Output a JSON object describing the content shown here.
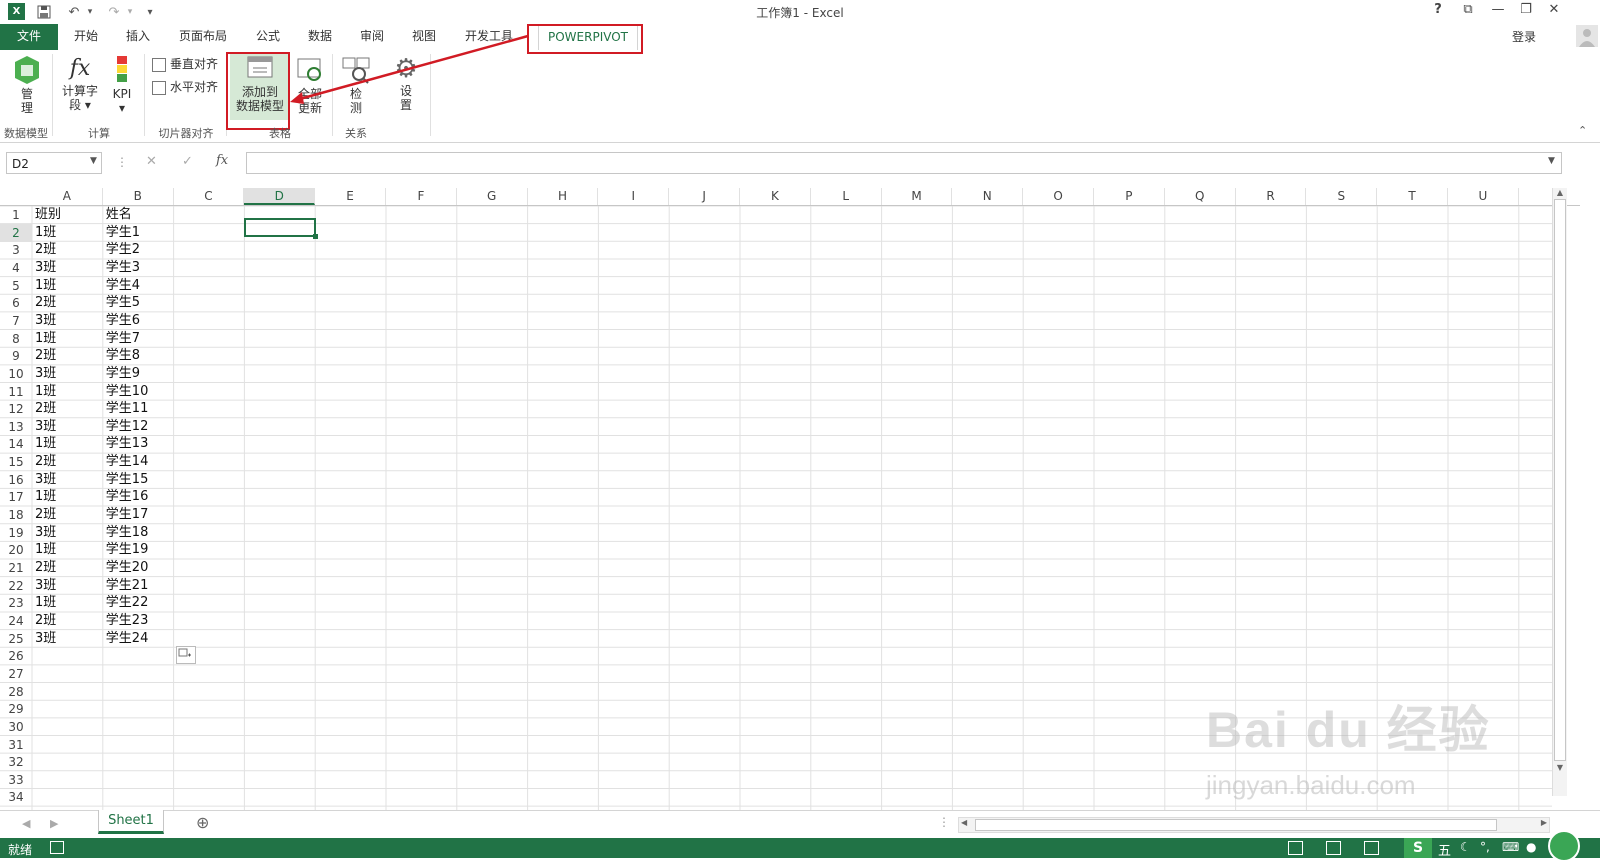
{
  "window": {
    "title": "工作簿1 - Excel",
    "help": "?",
    "ribbon_display": "⧉",
    "minimize": "—",
    "restore": "❐",
    "close": "✕"
  },
  "qat": {
    "undo": "↶",
    "redo": "↷",
    "customize": "▾"
  },
  "tabs": [
    "文件",
    "开始",
    "插入",
    "页面布局",
    "公式",
    "数据",
    "审阅",
    "视图",
    "开发工具",
    "POWERPIVOT"
  ],
  "signin": "登录",
  "ribbon": {
    "manage": "管\n理",
    "calc_field": "计算字\n段 ▾",
    "kpi": "KPI\n▾",
    "vert_align": "垂直对齐",
    "horz_align": "水平对齐",
    "add_to_model": "添加到\n数据模型",
    "refresh_all": "全部\n更新",
    "detect": "检\n测",
    "settings": "设\n置",
    "groups": [
      "数据模型",
      "计算",
      "切片器对齐",
      "表格",
      "关系"
    ]
  },
  "formula_bar": {
    "name_box": "D2",
    "cancel": "✕",
    "enter": "✓",
    "fx": "fx",
    "value": ""
  },
  "columns": [
    "A",
    "B",
    "C",
    "D",
    "E",
    "F",
    "G",
    "H",
    "I",
    "J",
    "K",
    "L",
    "M",
    "N",
    "O",
    "P",
    "Q",
    "R",
    "S",
    "T",
    "U"
  ],
  "rows": [
    "1",
    "2",
    "3",
    "4",
    "5",
    "6",
    "7",
    "8",
    "9",
    "10",
    "11",
    "12",
    "13",
    "14",
    "15",
    "16",
    "17",
    "18",
    "19",
    "20",
    "21",
    "22",
    "23",
    "24",
    "25",
    "26",
    "27",
    "28",
    "29",
    "30",
    "31",
    "32",
    "33",
    "34"
  ],
  "table": {
    "col_a": [
      "班别",
      "1班",
      "2班",
      "3班",
      "1班",
      "2班",
      "3班",
      "1班",
      "2班",
      "3班",
      "1班",
      "2班",
      "3班",
      "1班",
      "2班",
      "3班",
      "1班",
      "2班",
      "3班",
      "1班",
      "2班",
      "3班",
      "1班",
      "2班",
      "3班"
    ],
    "col_b": [
      "姓名",
      "学生1",
      "学生2",
      "学生3",
      "学生4",
      "学生5",
      "学生6",
      "学生7",
      "学生8",
      "学生9",
      "学生10",
      "学生11",
      "学生12",
      "学生13",
      "学生14",
      "学生15",
      "学生16",
      "学生17",
      "学生18",
      "学生19",
      "学生20",
      "学生21",
      "学生22",
      "学生23",
      "学生24"
    ]
  },
  "selected_cell": "D2",
  "sheets": [
    "Sheet1"
  ],
  "add_sheet": "⊕",
  "status": {
    "ready": "就绪",
    "ime": "五"
  },
  "watermark": {
    "logo": "Bai du 经验",
    "url": "jingyan.baidu.com"
  },
  "colors": {
    "excel_green": "#217346",
    "highlight_red": "#d11b24",
    "grid_line": "#e1e1e1"
  }
}
